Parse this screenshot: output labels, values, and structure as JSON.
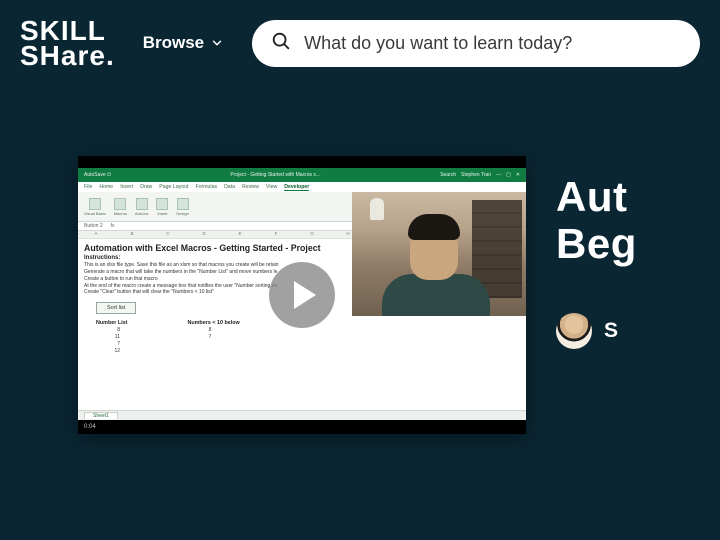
{
  "header": {
    "logo_line1": "SKILL",
    "logo_line2": "SHare",
    "browse_label": "Browse",
    "search_placeholder": "What do you want to learn today?"
  },
  "video": {
    "excel": {
      "title_center": "Project - Getting Started with Macros x…",
      "search_hint": "Search",
      "user": "Stephen Tran",
      "menu": [
        "File",
        "Home",
        "Insert",
        "Draw",
        "Page Layout",
        "Formulas",
        "Data",
        "Review",
        "View",
        "Developer"
      ],
      "active_menu_index": 9,
      "formula_cellref": "Button 2",
      "doc_title": "Automation with Excel Macros - Getting Started - Project",
      "instructions_heading": "Instructions:",
      "instructions": [
        "This is an xlsx file type.  Save this file as an xlsm so that macros you create will be retain",
        "Generate a macro that will take the numbers in the \"Number List\" and move numbers le",
        "Create a button to run that macro",
        "At the end of the macro create a message box that notifies the user \"Number sorting co",
        "Create \"Clear\" button that will clear the \"Numbers < 10 list\""
      ],
      "sort_button": "Sort list",
      "list1_heading": "Number List",
      "list1": [
        "8",
        "11",
        "7",
        "12"
      ],
      "list2_heading": "Numbers < 10 below",
      "list2": [
        "8",
        "",
        "7",
        ""
      ],
      "sheet_tab": "Sheet1",
      "col_letters": [
        "A",
        "B",
        "C",
        "D",
        "E",
        "F",
        "G",
        "H",
        "I"
      ]
    },
    "track_current": "0:04"
  },
  "course": {
    "title_line1": "Aut",
    "title_line2": "Beg",
    "author_initial": "S"
  }
}
